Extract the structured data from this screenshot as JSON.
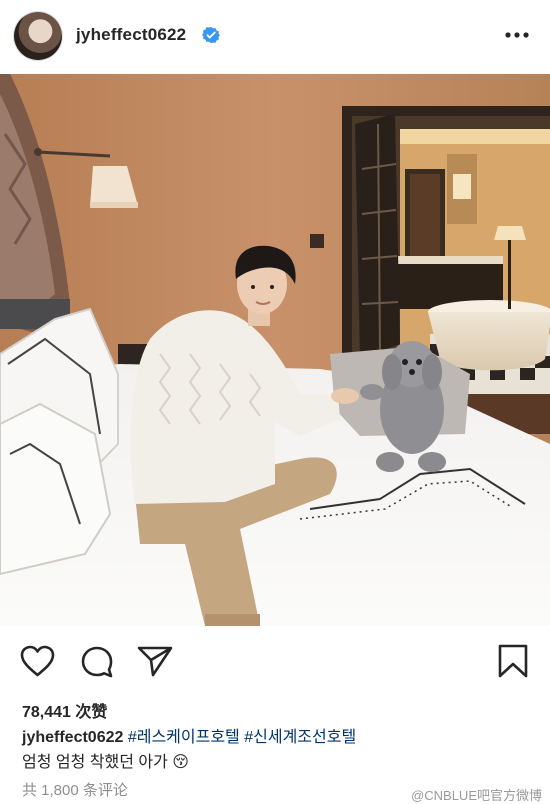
{
  "post": {
    "username": "jyheffect0622",
    "verified": true,
    "likes_text": "78,441 次赞",
    "caption_user": "jyheffect0622",
    "hashtags": [
      "#레스케이프호텔",
      "#신세계조선호텔"
    ],
    "caption_line2": "엄청 엄청 착했던 아가",
    "caption_emoji": "😚",
    "comments_text": "共 1,800 条评论",
    "watermark": "@CNBLUE吧官方微博"
  },
  "icons": {
    "more": "more-horizontal-icon",
    "like": "heart-icon",
    "comment": "comment-icon",
    "share": "paper-plane-icon",
    "save": "bookmark-icon",
    "verified": "verified-badge-icon"
  },
  "colors": {
    "hashtag": "#003569",
    "verified": "#3897f0",
    "muted": "#8e8e8e"
  }
}
